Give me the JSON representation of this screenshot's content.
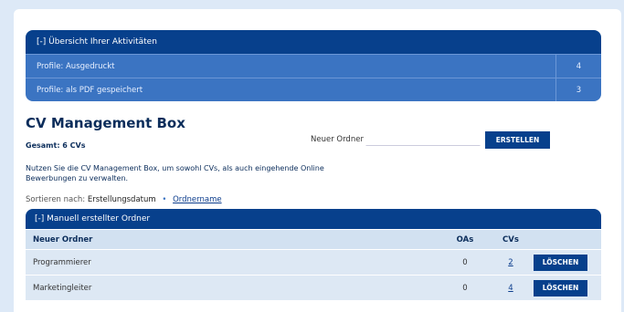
{
  "activities": {
    "header": "[-] Übersicht Ihrer Aktivitäten",
    "rows": [
      {
        "label": "Profile: Ausgedruckt",
        "count": "4"
      },
      {
        "label": "Profile: als PDF gespeichert",
        "count": "3"
      }
    ]
  },
  "box": {
    "title": "CV Management Box",
    "total": "Gesamt: 6 CVs",
    "info": "Nutzen Sie die CV Management Box, um sowohl CVs, als auch eingehende Online Bewerbungen zu verwalten."
  },
  "new_folder": {
    "label": "Neuer Ordner",
    "value": "",
    "button": "ERSTELLEN"
  },
  "sort": {
    "label": "Sortieren nach:",
    "current": "Erstellungsdatum",
    "separator": "•",
    "link": "Ordnername"
  },
  "folders": {
    "header": "[-] Manuell erstellter Ordner",
    "columns": {
      "name": "Neuer Ordner",
      "oas": "OAs",
      "cvs": "CVs"
    },
    "rows": [
      {
        "name": "Programmierer",
        "oas": "0",
        "cvs": "2",
        "action": "LÖSCHEN"
      },
      {
        "name": "Marketingleiter",
        "oas": "0",
        "cvs": "4",
        "action": "LÖSCHEN"
      }
    ]
  },
  "colors": {
    "primary": "#07408c",
    "secondary": "#3b74c2",
    "background": "#dde9f7"
  }
}
